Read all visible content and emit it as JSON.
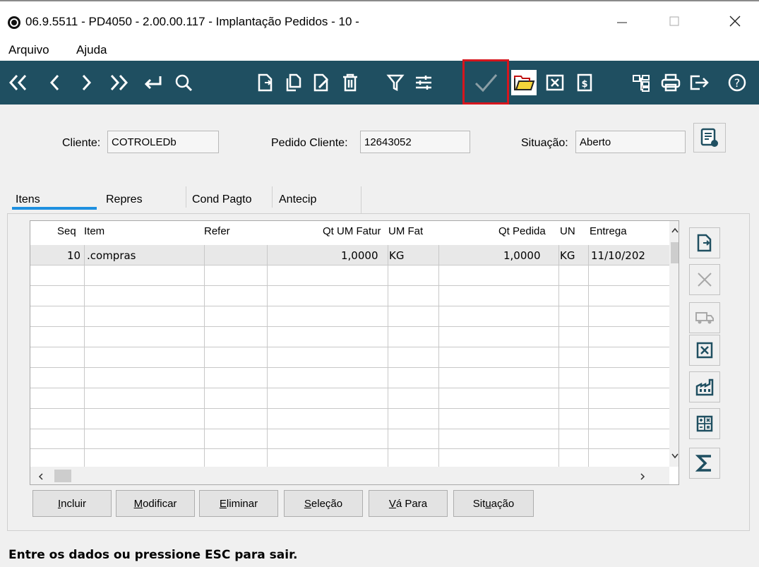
{
  "window": {
    "title": "06.9.5511 - PD4050 - 2.00.00.117 - Implantação Pedidos - 10 -",
    "controls": {
      "minimize": "minimize-icon",
      "maximize": "maximize-icon",
      "close": "close-icon"
    }
  },
  "menu": {
    "items": [
      "Arquivo",
      "Ajuda"
    ]
  },
  "toolbar": {
    "icons": [
      "first-record-icon",
      "previous-record-icon",
      "next-record-icon",
      "last-record-icon",
      "goto-icon",
      "search-icon",
      "new-icon",
      "copy-icon",
      "edit-icon",
      "delete-icon",
      "filter-icon",
      "settings-icon",
      "confirm-icon",
      "open-folder-icon",
      "cancel-icon",
      "document-money-icon",
      "tree-icon",
      "print-icon",
      "exit-icon",
      "help-icon"
    ],
    "highlighted": "confirm-icon",
    "background": "#1f4f61",
    "highlight_color": "#d6161e"
  },
  "header": {
    "cliente_label": "Cliente:",
    "cliente_value": "COTROLEDb",
    "pedido_cliente_label": "Pedido Cliente:",
    "pedido_cliente_value": "12643052",
    "situacao_label": "Situação:",
    "situacao_value": "Aberto"
  },
  "tabs": [
    "Itens",
    "Repres",
    "Cond Pagto",
    "Antecip"
  ],
  "active_tab": "Itens",
  "grid": {
    "columns": [
      "Seq",
      "Item",
      "Refer",
      "Qt UM Fatur",
      "UM Fat",
      "Qt Pedida",
      "UN",
      "Entrega"
    ],
    "rows": [
      {
        "seq": "10",
        "item": ".compras",
        "refer": "",
        "qt_um_fatur": "1,0000",
        "um_fat": "KG",
        "qt_pedida": "1,0000",
        "un": "KG",
        "entrega": "11/10/202"
      }
    ]
  },
  "side_buttons": [
    "add-item-icon",
    "remove-item-icon",
    "delivery-truck-icon",
    "cancel-item-icon",
    "factory-icon",
    "calculator-icon",
    "sum-icon"
  ],
  "buttons": {
    "incluir": {
      "u": "I",
      "rest": "ncluir"
    },
    "modificar": {
      "u": "M",
      "rest": "odificar"
    },
    "eliminar": {
      "u": "E",
      "rest": "liminar"
    },
    "selecao": {
      "u": "S",
      "rest": "eleção"
    },
    "va_para": {
      "u": "V",
      "rest": "á Para"
    },
    "situacao": {
      "pre": "Sit",
      "u": "u",
      "rest": "ação"
    }
  },
  "status": "Entre os dados ou pressione ESC para sair."
}
